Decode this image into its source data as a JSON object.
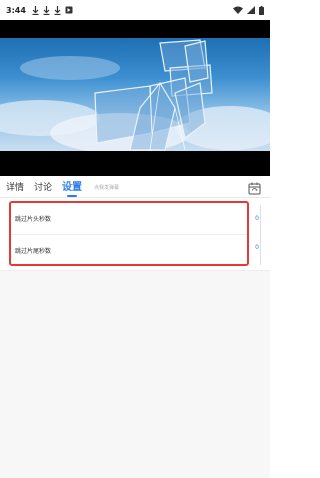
{
  "status_bar": {
    "time": "3:44",
    "notification_icons": [
      "download-icon",
      "download-icon",
      "download-icon",
      "app-notification-icon"
    ],
    "right_icons": [
      "wifi-icon",
      "signal-icon",
      "battery-icon"
    ]
  },
  "video": {
    "state": "playing"
  },
  "tabs": {
    "items": [
      {
        "label": "详情"
      },
      {
        "label": "讨论"
      },
      {
        "label": "设置"
      }
    ],
    "active_index": 2,
    "hint": "点我发弹幕",
    "right_icon": "calendar-sync-icon"
  },
  "settings": {
    "skip_intro_label": "跳过片头秒数",
    "skip_intro_value": "0",
    "skip_outro_label": "跳过片尾秒数",
    "skip_outro_value": "0"
  },
  "colors": {
    "accent": "#2b7de9",
    "highlight_border": "#e53935"
  }
}
